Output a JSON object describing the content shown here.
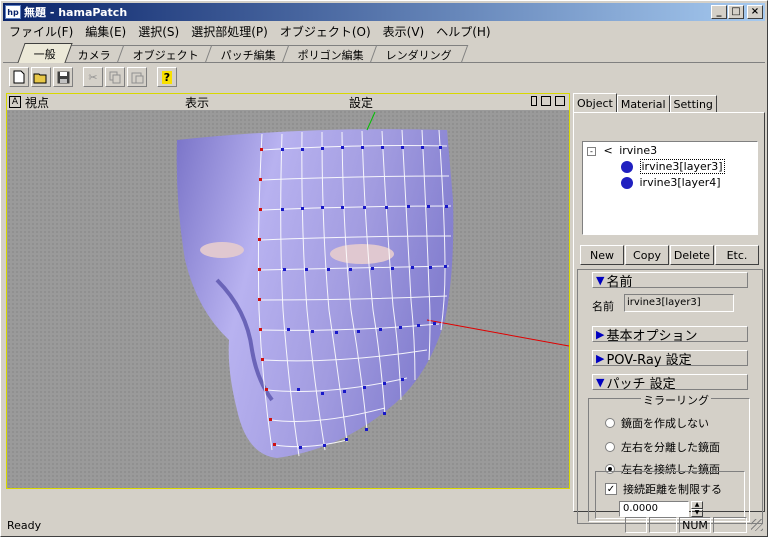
{
  "window": {
    "app_icon": "hp",
    "title": "無題 - hamaPatch",
    "controls": [
      "_",
      "□",
      "×"
    ]
  },
  "menu": [
    "ファイル(F)",
    "編集(E)",
    "選択(S)",
    "選択部処理(P)",
    "オブジェクト(O)",
    "表示(V)",
    "ヘルプ(H)"
  ],
  "main_tabs": [
    "一般",
    "カメラ",
    "オブジェクト",
    "パッチ編集",
    "ポリゴン編集",
    "レンダリング"
  ],
  "toolbar_icons": [
    "new-file-icon",
    "open-folder-icon",
    "save-icon",
    "cut-icon",
    "copy-icon",
    "paste-icon",
    "help-icon"
  ],
  "viewport": {
    "corner_label": "A",
    "menu_view": "視点",
    "menu_display": "表示",
    "menu_settings": "設定"
  },
  "right_panel": {
    "tabs": [
      "Object",
      "Material",
      "Setting"
    ],
    "tree": {
      "root": "irvine3",
      "children": [
        "irvine3[layer3]",
        "irvine3[layer4]"
      ]
    },
    "buttons": [
      "New",
      "Copy",
      "Delete",
      "Etc."
    ],
    "name_section": "名前",
    "name_label": "名前",
    "name_value": "irvine3[layer3]",
    "basic_options": "基本オプション",
    "povray": "POV-Ray 設定",
    "patch": "パッチ 設定",
    "mirror_group": "ミラーリング",
    "radio_none": "鏡面を作成しない",
    "radio_separate": "左右を分離した鏡面",
    "radio_connect": "左右を接続した鏡面",
    "limit_checkbox": "接続距離を制限する",
    "limit_value": "0.0000"
  },
  "statusbar": {
    "text": "Ready",
    "num": "NUM"
  },
  "colors": {
    "title_start": "#0a246a",
    "face": "#a9a3e8",
    "mesh_line": "#ffffff",
    "vertex": "#1818c8",
    "seam_vertex": "#d01010",
    "axis_red": "#e00000"
  }
}
